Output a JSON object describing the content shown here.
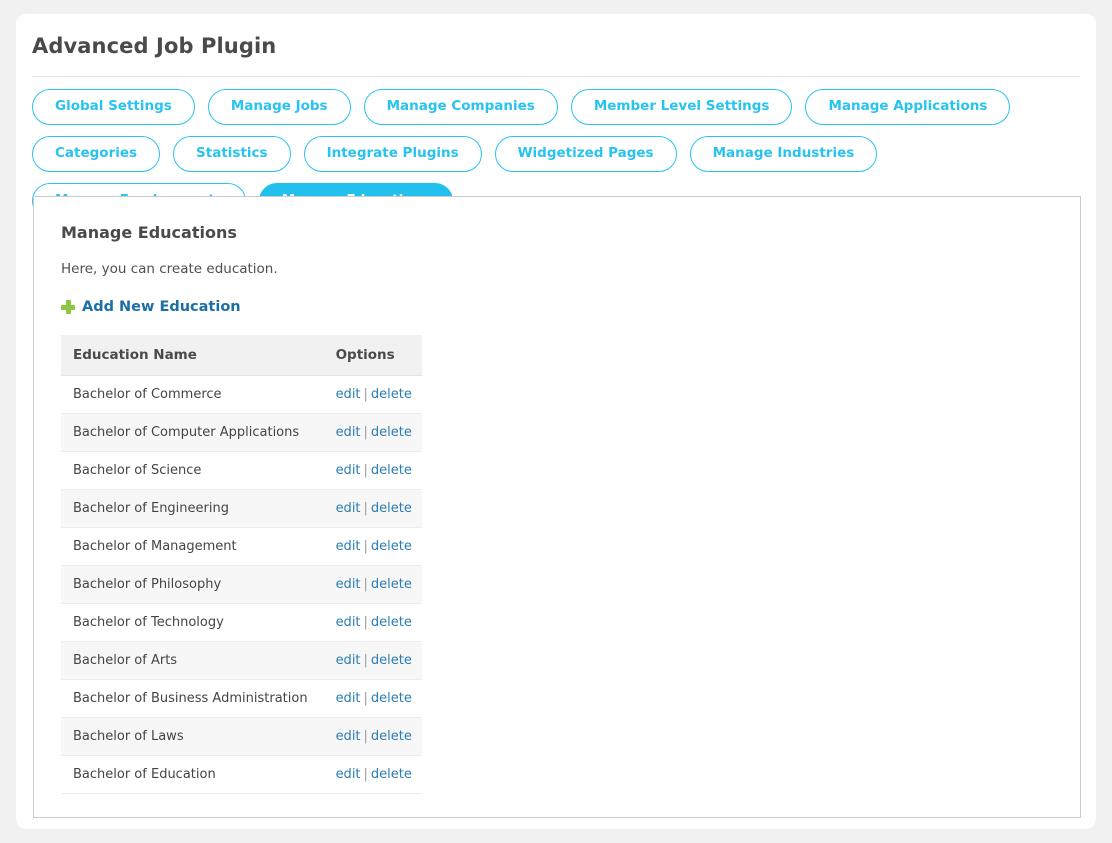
{
  "header": {
    "title": "Advanced Job Plugin"
  },
  "tabs": [
    {
      "label": "Global Settings",
      "active": false
    },
    {
      "label": "Manage Jobs",
      "active": false
    },
    {
      "label": "Manage Companies",
      "active": false
    },
    {
      "label": "Member Level Settings",
      "active": false
    },
    {
      "label": "Manage Applications",
      "active": false
    },
    {
      "label": "Categories",
      "active": false
    },
    {
      "label": "Statistics",
      "active": false
    },
    {
      "label": "Integrate Plugins",
      "active": false
    },
    {
      "label": "Widgetized Pages",
      "active": false
    },
    {
      "label": "Manage Industries",
      "active": false
    },
    {
      "label": "Manage Employments",
      "active": false
    },
    {
      "label": "Manage Educations",
      "active": true
    }
  ],
  "panel": {
    "heading": "Manage Educations",
    "description": "Here, you can create education.",
    "add_new_label": "Add New Education",
    "add_icon": "plus-icon",
    "table": {
      "columns": [
        "Education Name",
        "Options"
      ],
      "edit_label": "edit",
      "separator": "|",
      "delete_label": "delete",
      "rows": [
        {
          "name": "Bachelor of Commerce"
        },
        {
          "name": "Bachelor of Computer Applications"
        },
        {
          "name": "Bachelor of Science"
        },
        {
          "name": "Bachelor of Engineering"
        },
        {
          "name": "Bachelor of Management"
        },
        {
          "name": "Bachelor of Philosophy"
        },
        {
          "name": "Bachelor of Technology"
        },
        {
          "name": "Bachelor of Arts"
        },
        {
          "name": "Bachelor of Business Administration"
        },
        {
          "name": "Bachelor of Laws"
        },
        {
          "name": "Bachelor of Education"
        }
      ]
    }
  },
  "colors": {
    "accent": "#22c0ec",
    "accent_border": "#29c3ef",
    "link": "#2b7cb3",
    "add_link": "#1a6fa8",
    "plus_green": "#8dc63f",
    "page_bg": "#f1f1f1",
    "text": "#4a4a4a"
  }
}
